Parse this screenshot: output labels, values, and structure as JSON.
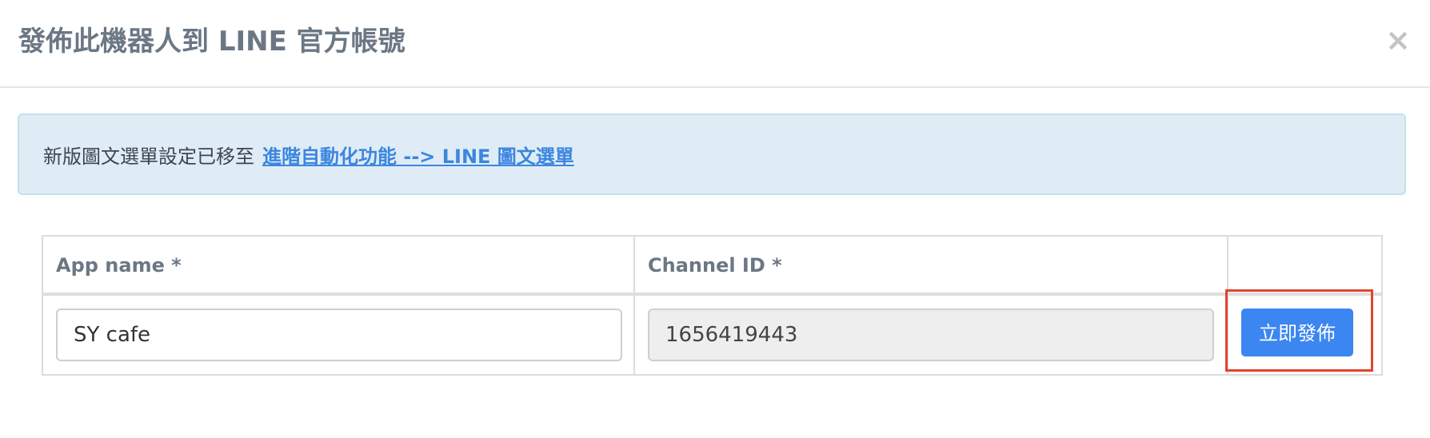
{
  "modal": {
    "title": "發佈此機器人到 LINE 官方帳號",
    "close_label": "×"
  },
  "alert": {
    "text": "新版圖文選單設定已移至",
    "link_text": "進階自動化功能 --> LINE 圖文選單"
  },
  "table": {
    "headers": {
      "app_name": "App name *",
      "channel_id": "Channel ID *",
      "action": ""
    },
    "row": {
      "app_name_value": "SY cafe",
      "channel_id_value": "1656419443",
      "publish_label": "立即發佈"
    }
  },
  "colors": {
    "primary": "#3b86f0",
    "highlight": "#e0442c",
    "alert_bg": "#dfecf6",
    "link": "#3b86e0"
  }
}
